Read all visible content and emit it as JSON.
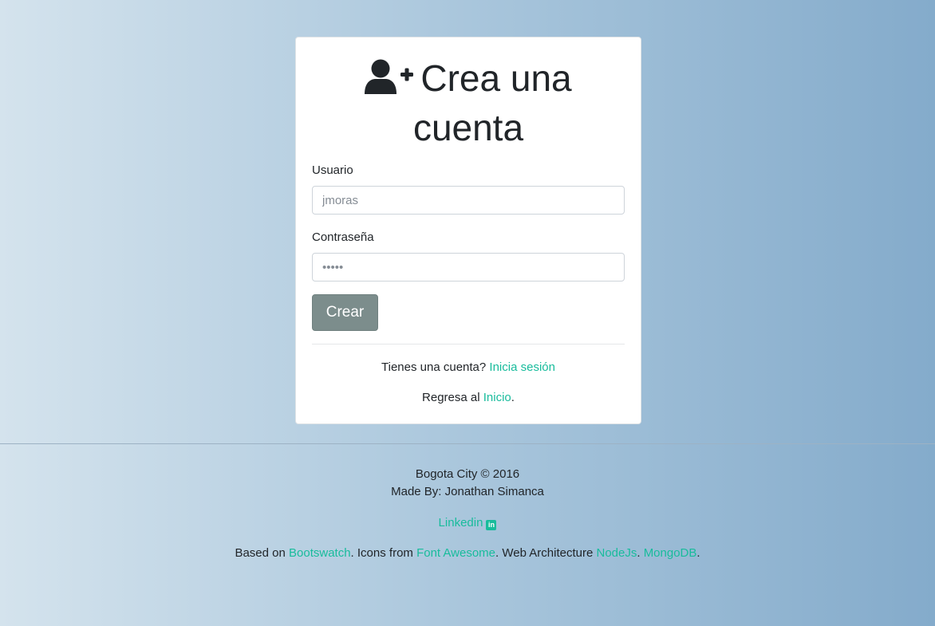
{
  "card": {
    "title_icon": "user-plus-icon",
    "title": "Crea una cuenta",
    "username_label": "Usuario",
    "username_placeholder": "jmoras",
    "password_label": "Contraseña",
    "password_placeholder": "•••••",
    "submit_label": "Crear",
    "have_account_text": "Tienes una cuenta?",
    "login_link": "Inicia sesión",
    "back_text": "Regresa al",
    "home_link": "Inicio",
    "back_period": "."
  },
  "footer": {
    "copyright": "Bogota City © 2016",
    "made_by": "Made By: Jonathan Simanca",
    "linkedin_label": "Linkedin",
    "linkedin_icon": "linkedin-icon",
    "based_on_text": "Based on ",
    "bootswatch_link": "Bootswatch",
    "icons_from_text": ". Icons from ",
    "fontawesome_link": "Font Awesome",
    "architecture_text": ". Web Architecture ",
    "nodejs_link": "NodeJs",
    "separator": ". ",
    "mongodb_link": "MongoDB",
    "end_period": "."
  },
  "colors": {
    "link": "#18bc9c",
    "button": "#7c8d8c",
    "text": "#212529"
  }
}
